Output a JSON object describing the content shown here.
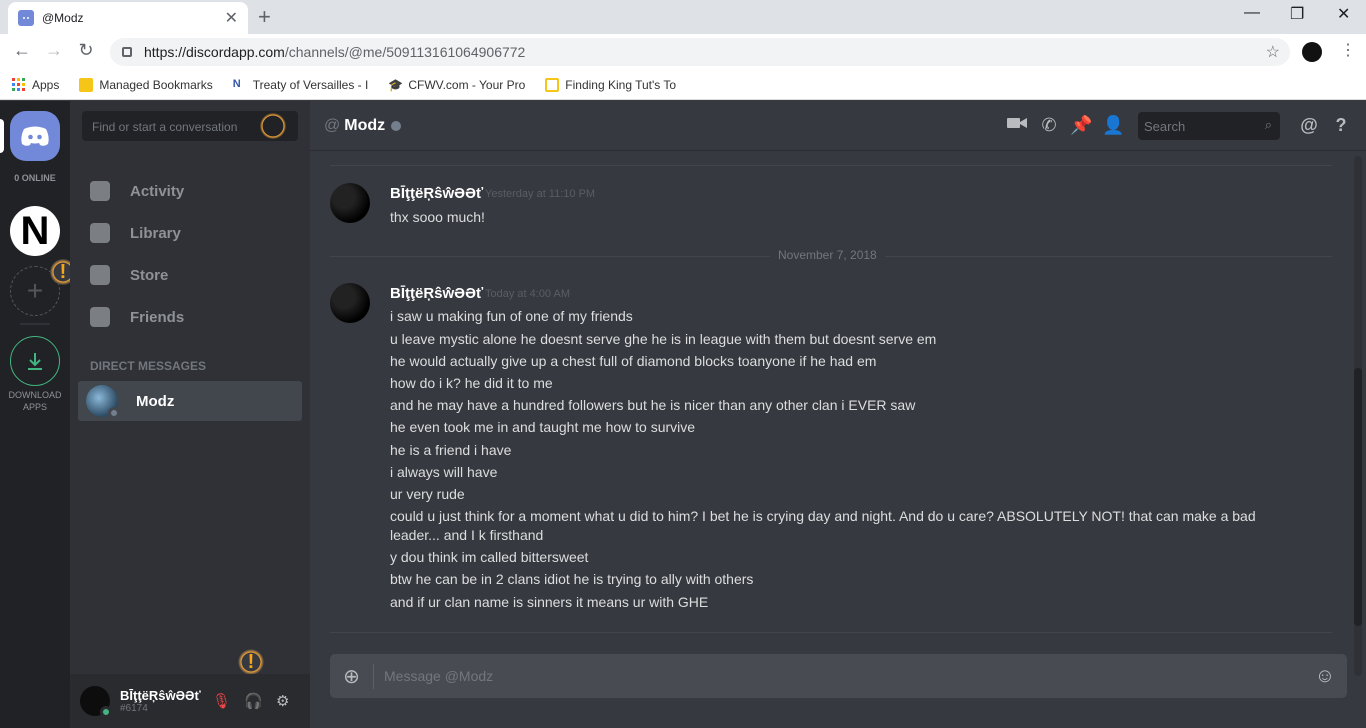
{
  "browser": {
    "tab_title": "@Modz",
    "new_tab": "+",
    "url_host": "https://discordapp.com",
    "url_path": "/channels/@me/509113161064906772",
    "bookmarks": [
      "Apps",
      "Managed Bookmarks",
      "Treaty of Versailles - I",
      "CFWV.com - Your Pro",
      "Finding King Tut's To"
    ]
  },
  "servers": {
    "online_count": "0 ONLINE",
    "server_letter": "N",
    "download_label": "DOWNLOAD APPS",
    "warning_mark": "!"
  },
  "channels": {
    "search_placeholder": "Find or start a conversation",
    "nav": [
      "Activity",
      "Library",
      "Store",
      "Friends"
    ],
    "dm_header": "DIRECT MESSAGES",
    "dm_name": "Modz"
  },
  "user": {
    "name": "BĪţţëŖŝŵƏƏť",
    "tag": "#6174"
  },
  "chat": {
    "at_symbol": "@",
    "title": "Modz",
    "search_placeholder": "Search",
    "composer_placeholder": "Message @Modz",
    "date_divider": "November 7, 2018",
    "messages": [
      {
        "author": "BĪţţëŖŝŵƏƏť",
        "time": "Yesterday at 11:10 PM",
        "lines": [
          "thx sooo much!"
        ]
      },
      {
        "author": "BĪţţëŖŝŵƏƏť",
        "time": "Today at 4:00 AM",
        "lines": [
          "i saw u making fun of one of my friends",
          "u leave mystic alone he doesnt serve ghe he is in league with them but doesnt serve em",
          "he would actually give up a chest full of diamond blocks toanyone if he had em",
          "how do i k? he did it to me",
          "and he may have a hundred followers but he is nicer than any other clan i EVER saw",
          "he even took me in and taught me how to survive",
          "he is a friend i have",
          "i always will have",
          "ur very rude",
          "could u just think for a moment what u did to him? I bet he is crying day and night. And do u care? ABSOLUTELY NOT! that can make a bad",
          "leader... and I k firsthand",
          "y dou think im called bittersweet",
          "btw he can be in 2 clans idiot he is trying to ally with others",
          "and if ur clan name is sinners it means ur with GHE"
        ]
      }
    ]
  },
  "colors": {
    "blurple": "#7289da",
    "online": "#43b581",
    "warning": "#faa61a"
  }
}
